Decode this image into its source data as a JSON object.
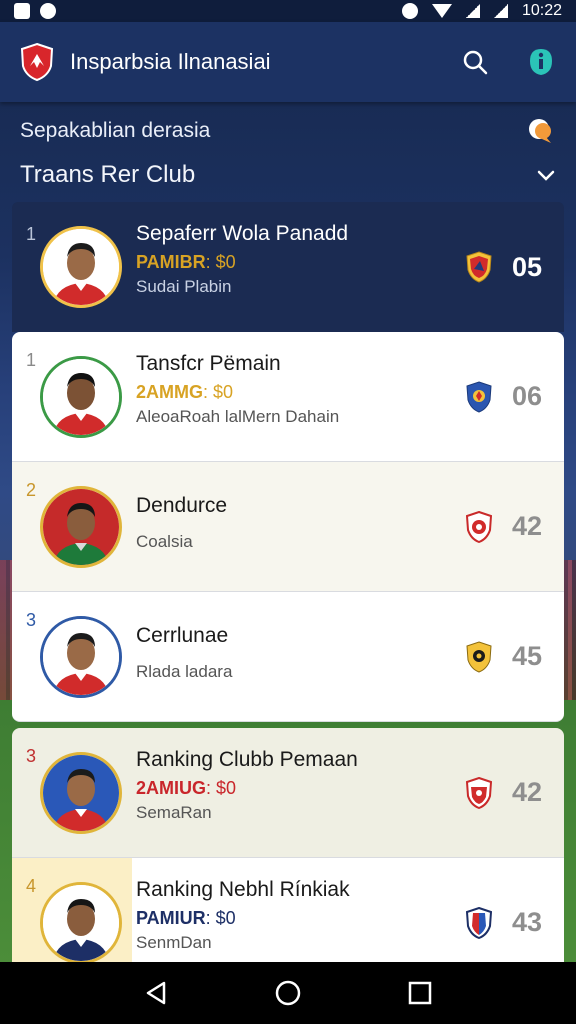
{
  "status_bar": {
    "time": "10:22"
  },
  "app_bar": {
    "title": "Insparbsia Ilnanasiai"
  },
  "section": {
    "subtitle": "Sepakablian derasia",
    "title": "Traans Rer Club"
  },
  "featured": {
    "rank": "1",
    "name": "Sepaferr Wola Panadd",
    "price_key": "PAMIBR",
    "price_value": ": $0",
    "sub": "Sudai Plabin",
    "score": "05"
  },
  "players": [
    {
      "rank": "1",
      "name": "Tansfcr Pëmain",
      "price_key": "2AMMG",
      "price_value": ": $0",
      "sub": "AleoaRoah lalMern Dahain",
      "score": "06"
    },
    {
      "rank": "2",
      "name": "Dendurce",
      "price_key": "",
      "price_value": "",
      "sub": "Coalsia",
      "score": "42"
    },
    {
      "rank": "3",
      "name": "Cerrlunae",
      "price_key": "",
      "price_value": "",
      "sub": "Rlada ladara",
      "score": "45"
    },
    {
      "rank": "3",
      "name": "Ranking Clubb Pemaan",
      "price_key": "2AMIUG",
      "price_value": ": $0",
      "sub": "SemaRan",
      "score": "42"
    },
    {
      "rank": "4",
      "name": "Ranking Nebhl Rínkiak",
      "price_key": "PAMIUR",
      "price_value": ": $0",
      "sub": "SenmDan",
      "score": "43"
    }
  ],
  "colors": {
    "app_bar": "#1c3263",
    "featured_bg": "#1b2b52",
    "price_gold": "#d8a324",
    "price_red": "#c9262b",
    "price_navy": "#1d2f66"
  }
}
